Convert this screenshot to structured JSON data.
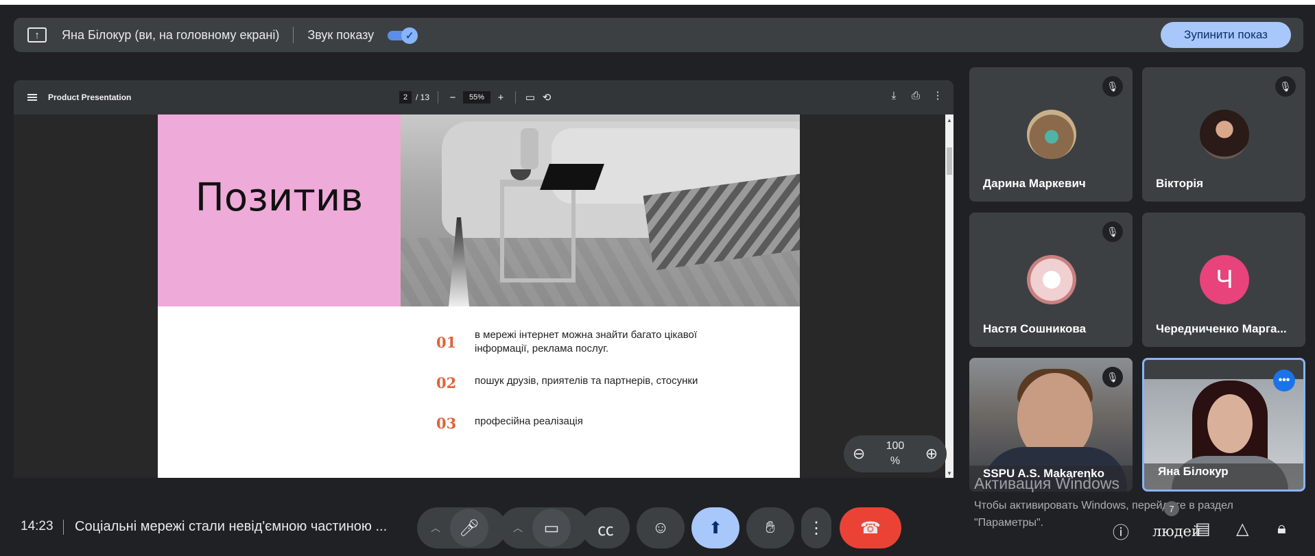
{
  "share_bar": {
    "presenter_text": "Яна Білокур (ви, на головному екрані)",
    "sound_label": "Звук показу",
    "sound_on": true,
    "stop_button": "Зупинити показ",
    "icon": "screen-share-icon"
  },
  "pdf": {
    "title": "Product Presentation",
    "current_page": "2",
    "total_pages": "/ 13",
    "zoom": "55%",
    "zoom_overlay_value": "100",
    "zoom_overlay_unit": "%"
  },
  "slide": {
    "heading": "Позитив",
    "items": [
      {
        "num": "01",
        "text": "в мережі інтернет можна знайти багато цікавої інформації, реклама послуг."
      },
      {
        "num": "02",
        "text": "пошук друзів, приятелів та  партнерів, стосунки"
      },
      {
        "num": "03",
        "text": "професійна реалізація"
      }
    ],
    "colors": {
      "pink": "#eeaad9",
      "accent": "#e0623a"
    }
  },
  "participants": [
    {
      "name": "Дарина Маркевич",
      "muted": true,
      "type": "avatar"
    },
    {
      "name": "Вікторія",
      "muted": true,
      "type": "avatar"
    },
    {
      "name": "Настя Сошникова",
      "muted": true,
      "type": "avatar"
    },
    {
      "name": "Чередниченко Марга...",
      "muted": false,
      "type": "letter",
      "letter": "Ч"
    },
    {
      "name": "SSPU A.S. Makarenko",
      "muted": true,
      "type": "video"
    },
    {
      "name": "Яна Білокур",
      "muted": false,
      "type": "video",
      "active": true
    }
  ],
  "watermark": {
    "title": "Активация Windows",
    "text": "Чтобы активировать Windows, перейдите в раздел \"Параметры\"."
  },
  "bottom_bar": {
    "time": "14:23",
    "meeting_title": "Соціальні мережі стали невід'ємною частиною ...",
    "people_count": "7",
    "people_label": "людей"
  }
}
